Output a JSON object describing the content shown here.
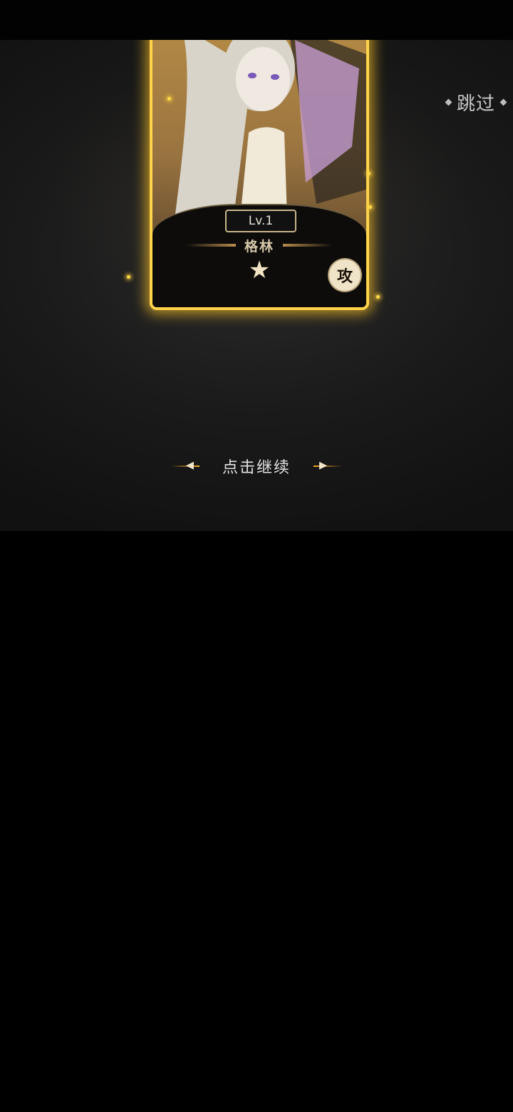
{
  "top_bar": {},
  "skip": {
    "label": "跳过"
  },
  "card": {
    "level": "Lv.1",
    "name": "格林",
    "stars": "★",
    "class_label": "攻"
  },
  "continue": {
    "label": "点击继续"
  },
  "colors": {
    "card_border": "#ffd34a",
    "glow": "#ffb02a",
    "background": "#1a1a1a"
  }
}
